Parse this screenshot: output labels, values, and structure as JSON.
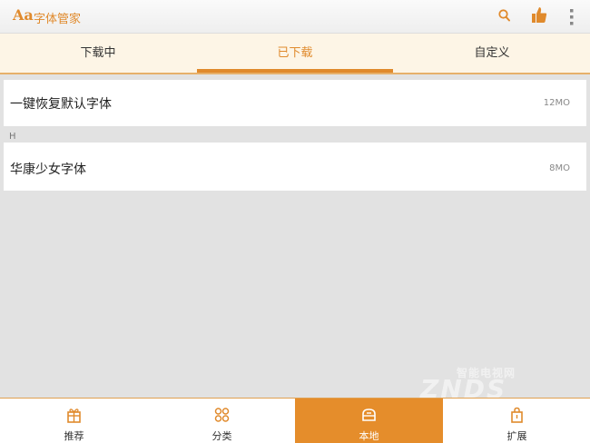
{
  "app": {
    "logo": "Aa",
    "title": "字体管家",
    "icons": [
      "search-icon",
      "thumbs-up-icon",
      "overflow-menu-icon"
    ]
  },
  "tabs": [
    {
      "label": "下载中",
      "active": false
    },
    {
      "label": "已下载",
      "active": true
    },
    {
      "label": "自定义",
      "active": false
    }
  ],
  "rows": [
    {
      "name": "一键恢复默认字体",
      "size": "12MO"
    },
    {
      "name": "华康少女字体",
      "size": "8MO"
    }
  ],
  "section_header": "H",
  "bottom_nav": [
    {
      "label": "推荐",
      "icon": "gift-icon",
      "active": false
    },
    {
      "label": "分类",
      "icon": "category-icon",
      "active": false
    },
    {
      "label": "本地",
      "icon": "local-storage-icon",
      "active": true
    },
    {
      "label": "扩展",
      "icon": "shopping-bag-icon",
      "active": false
    }
  ],
  "watermark": {
    "top_text": "智能电视网",
    "main_text": "ZNDS"
  },
  "colors": {
    "accent": "#e08a2c",
    "active_nav": "#e58d2b",
    "tab_bg": "#fdf5e6",
    "list_bg": "#e2e2e2"
  }
}
